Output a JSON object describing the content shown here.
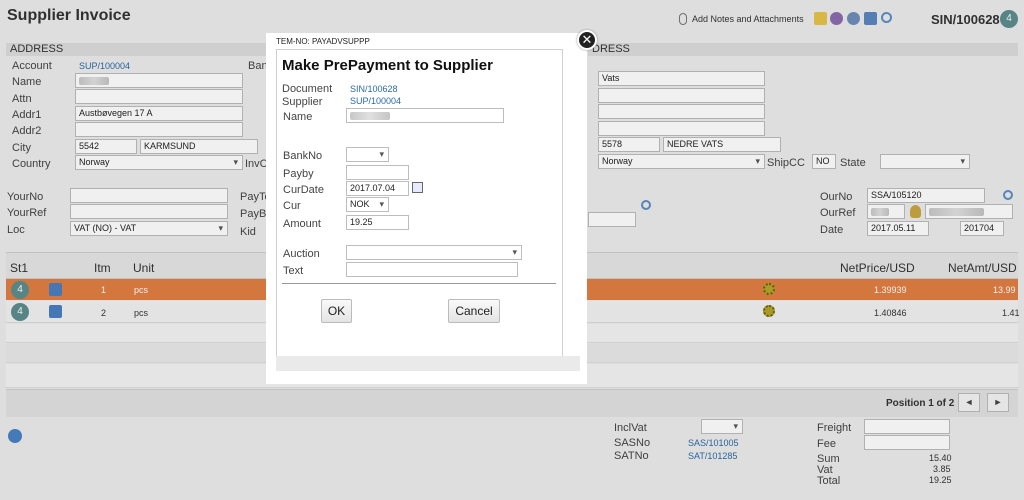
{
  "header": {
    "title": "Supplier Invoice",
    "notes_link": "Add Notes and Attachments",
    "doc_no": "SIN/100628",
    "badge": "4"
  },
  "address_left": {
    "section": "ADDRESS",
    "account_label": "Account",
    "account_value": "SUP/100004",
    "name_label": "Name",
    "attn_label": "Attn",
    "addr1_label": "Addr1",
    "addr1_value": "Austbøvegen 17 A",
    "addr2_label": "Addr2",
    "city_label": "City",
    "city_zip": "5542",
    "city_name": "KARMSUND",
    "country_label": "Country",
    "country_value": "Norway",
    "bank_label_partial": "Ban",
    "invc_label_partial": "InvC"
  },
  "address_right": {
    "section_partial": "DRESS",
    "line1": "Vats",
    "city_zip": "5578",
    "city_name": "NEDRE VATS",
    "country_value": "Norway",
    "shipcc_label": "ShipCC",
    "shipcc_value": "NO",
    "state_label": "State"
  },
  "refs": {
    "yourno_label": "YourNo",
    "yourref_label": "YourRef",
    "loc_label": "Loc",
    "loc_value": "VAT (NO) - VAT",
    "payte_label": "PayTe",
    "payby_label": "PayBy",
    "kid_label": "Kid",
    "ourno_label": "OurNo",
    "ourno_value": "SSA/105120",
    "ourref_label": "OurRef",
    "date_label": "Date",
    "date_value": "2017.05.11",
    "period_value": "201704"
  },
  "grid": {
    "headers": {
      "st": "St1",
      "itm": "Itm",
      "unit": "Unit",
      "netprice": "NetPrice/USD",
      "netamt": "NetAmt/USD"
    },
    "rows": [
      {
        "badge": "4",
        "itm": "1",
        "unit": "pcs",
        "netprice": "1.39939",
        "netamt": "13.99"
      },
      {
        "badge": "4",
        "itm": "2",
        "unit": "pcs",
        "netprice": "1.40846",
        "netamt": "1.41"
      }
    ],
    "position": "Position 1 of 2",
    "prev": "◄",
    "next": "►"
  },
  "footer": {
    "inclvat_label": "InclVat",
    "sasno_label": "SASNo",
    "sasno_value": "SAS/101005",
    "satno_label": "SATNo",
    "satno_value": "SAT/101285",
    "freight_label": "Freight",
    "fee_label": "Fee",
    "sum_label": "Sum",
    "sum_value": "15.40",
    "vat_label": "Vat",
    "vat_value": "3.85",
    "total_label": "Total",
    "total_value": "19.25"
  },
  "modal": {
    "tem_no": "TEM-NO: PAYADVSUPPP",
    "title": "Make PrePayment to Supplier",
    "document_label": "Document",
    "document_value": "SIN/100628",
    "supplier_label": "Supplier",
    "supplier_value": "SUP/100004",
    "name_label": "Name",
    "bankno_label": "BankNo",
    "payby_label": "Payby",
    "curdate_label": "CurDate",
    "curdate_value": "2017.07.04",
    "cur_label": "Cur",
    "cur_value": "NOK",
    "amount_label": "Amount",
    "amount_value": "19.25",
    "auction_label": "Auction",
    "text_label": "Text",
    "ok_label": "OK",
    "cancel_label": "Cancel",
    "close_glyph": "✕"
  },
  "colors": {
    "selected_row": "#e27f43",
    "badge": "#5d8d8e",
    "link": "#2a6aa8"
  }
}
